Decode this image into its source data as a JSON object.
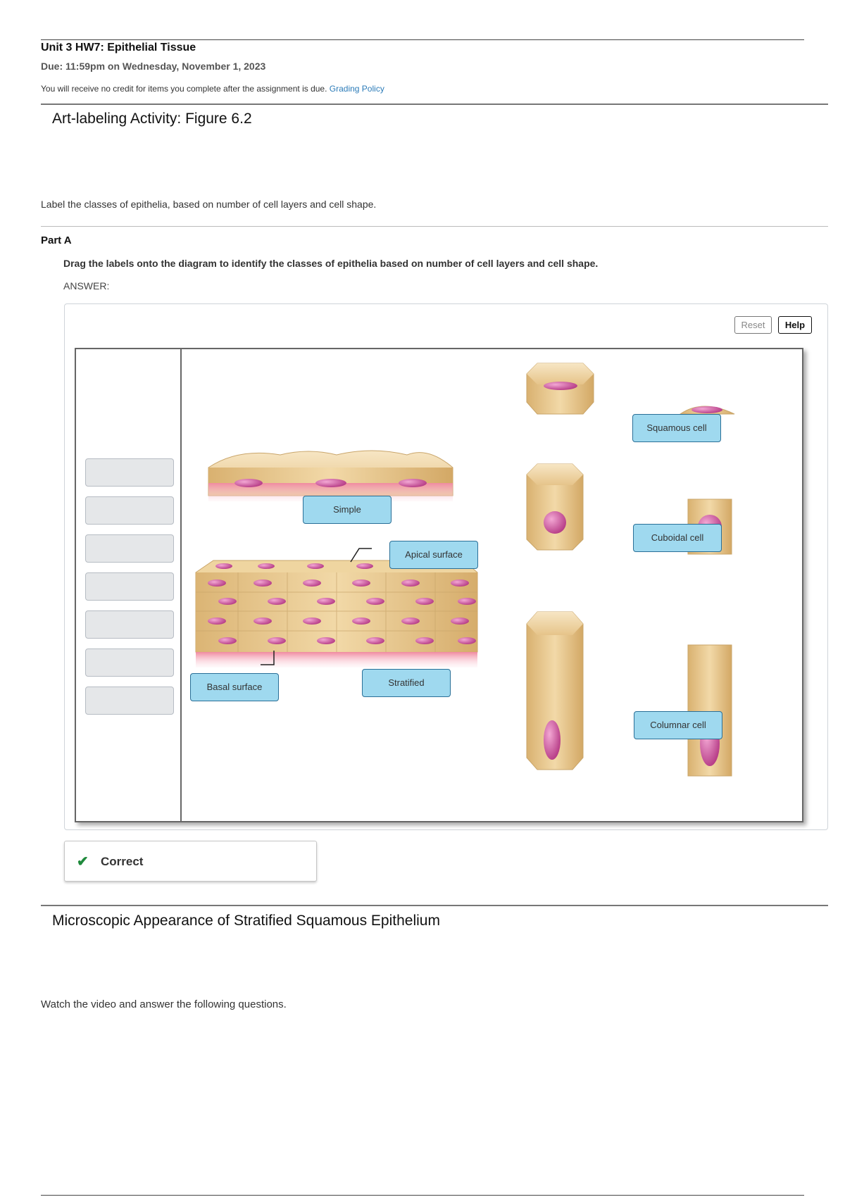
{
  "header": {
    "title": "Unit 3 HW7: Epithelial Tissue",
    "due": "Due: 11:59pm on Wednesday, November 1, 2023",
    "credit_notice": "You will receive no credit for items you complete after the assignment is due.",
    "grading_link": "Grading Policy"
  },
  "activity": {
    "title": "Art-labeling Activity: Figure 6.2",
    "intro": "Label the classes of epithelia, based on number of cell layers and cell shape.",
    "part_label": "Part A",
    "instruction": "Drag the labels onto the diagram to identify the classes of epithelia based on number of cell layers and cell shape.",
    "answer_label": "ANSWER:",
    "reset_label": "Reset",
    "help_label": "Help",
    "labels": {
      "simple": "Simple",
      "apical": "Apical surface",
      "basal": "Basal surface",
      "stratified": "Stratified",
      "squamous": "Squamous cell",
      "cuboidal": "Cuboidal cell",
      "columnar": "Columnar cell"
    },
    "feedback": "Correct",
    "feedback_icon": "checkmark-icon",
    "colors": {
      "label_fill": "#9fd9ef",
      "label_border": "#2a6f97",
      "correct": "#1f8a3c",
      "nucleus": "#c2488f",
      "cell": "#e8c98f"
    }
  },
  "next_section": {
    "title": "Microscopic Appearance of Stratified Squamous Epithelium",
    "intro": "Watch the video and answer the following questions."
  }
}
